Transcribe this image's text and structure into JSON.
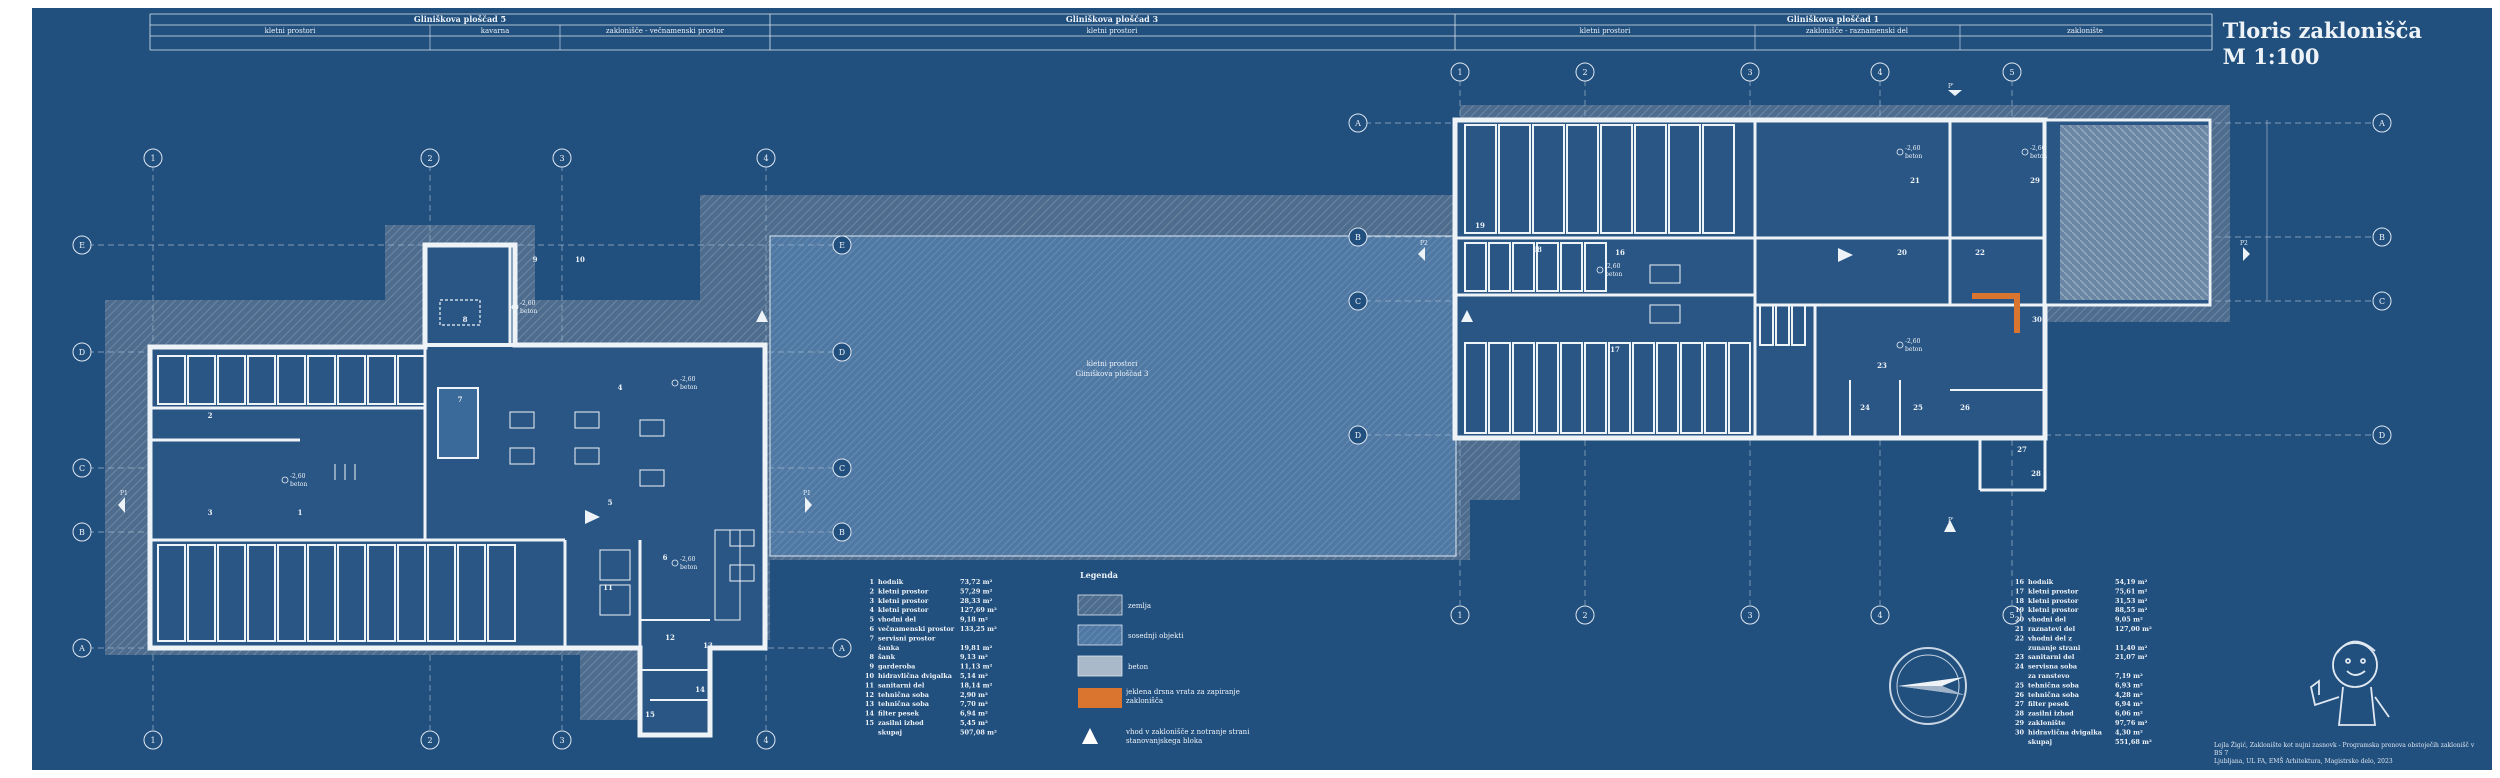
{
  "title": {
    "line1": "Tloris zaklonišča",
    "line2": "M  1:100"
  },
  "header": [
    {
      "name": "Gliniškova ploščad 5",
      "zones": [
        "kletni prostori",
        "kavarna",
        "zaklonišče - večnamenski prostor"
      ]
    },
    {
      "name": "Gliniškova ploščad 3",
      "zones": [
        "kletni prostori"
      ]
    },
    {
      "name": "Gliniškova ploščad 1",
      "zones": [
        "kletni prostori",
        "zaklonišče - raznamenski del",
        "zaklonište"
      ]
    }
  ],
  "plan_labels": {
    "central_1": "kletni prostori",
    "central_2": "Gliniškova ploščad 3",
    "beton": "beton",
    "beton_level": "-2,60",
    "p1": "P1",
    "p2": "P2",
    "p_prime": "P'"
  },
  "grid_left_numbers": [
    "1",
    "2",
    "3",
    "4"
  ],
  "grid_right_numbers": [
    "1",
    "2",
    "3",
    "4",
    "5"
  ],
  "grid_letters": [
    "E",
    "D",
    "C",
    "B",
    "A"
  ],
  "room_numbers_left": [
    "1",
    "2",
    "3",
    "4",
    "5",
    "6",
    "7",
    "8",
    "9",
    "10",
    "11",
    "12",
    "13",
    "14",
    "15"
  ],
  "room_numbers_right": [
    "16",
    "17",
    "18",
    "19",
    "20",
    "21",
    "22",
    "23",
    "24",
    "25",
    "26",
    "27",
    "28",
    "29",
    "30"
  ],
  "room_table_left": [
    {
      "n": "1",
      "name": "hodnik",
      "area": "73,72 m²"
    },
    {
      "n": "2",
      "name": "kletni prostor",
      "area": "57,29 m²"
    },
    {
      "n": "3",
      "name": "kletni prostor",
      "area": "28,33 m²"
    },
    {
      "n": "4",
      "name": "kletni prostor",
      "area": "127,69 m²"
    },
    {
      "n": "5",
      "name": "vhodni del",
      "area": "9,18 m²"
    },
    {
      "n": "6",
      "name": "večnamenski prostor",
      "area": "133,25 m²"
    },
    {
      "n": "7",
      "name": "servisni prostor",
      "area": ""
    },
    {
      "n": "",
      "name": "šanka",
      "area": "19,81 m²"
    },
    {
      "n": "8",
      "name": "šank",
      "area": "9,13 m²"
    },
    {
      "n": "9",
      "name": "garderoba",
      "area": "11,13 m²"
    },
    {
      "n": "10",
      "name": "hidravlična dvigalka",
      "area": "5,14 m²"
    },
    {
      "n": "11",
      "name": "sanitarni del",
      "area": "18,14 m²"
    },
    {
      "n": "12",
      "name": "tehnična soba",
      "area": "2,90 m²"
    },
    {
      "n": "13",
      "name": "tehnična soba",
      "area": "7,70 m²"
    },
    {
      "n": "14",
      "name": "filter pesek",
      "area": "6,94 m²"
    },
    {
      "n": "15",
      "name": "zasilni izhod",
      "area": "5,45 m²"
    },
    {
      "n": "",
      "name": "skupaj",
      "area": "507,08 m²"
    }
  ],
  "room_table_right": [
    {
      "n": "16",
      "name": "hodnik",
      "area": "54,19 m²"
    },
    {
      "n": "17",
      "name": "kletni prostor",
      "area": "75,61 m²"
    },
    {
      "n": "18",
      "name": "kletni prostor",
      "area": "31,53 m²"
    },
    {
      "n": "19",
      "name": "kletni prostor",
      "area": "88,55 m²"
    },
    {
      "n": "20",
      "name": "vhodni del",
      "area": "9,05 m²"
    },
    {
      "n": "21",
      "name": "raznatevi del",
      "area": "127,00 m²"
    },
    {
      "n": "22",
      "name": "vhodni del z",
      "area": ""
    },
    {
      "n": "",
      "name": "zunanje strani",
      "area": "11,40 m²"
    },
    {
      "n": "23",
      "name": "sanitarni del",
      "area": "21,07 m²"
    },
    {
      "n": "24",
      "name": "servisna soba",
      "area": ""
    },
    {
      "n": "",
      "name": "za ranstevo",
      "area": "7,19 m²"
    },
    {
      "n": "25",
      "name": "tehnična soba",
      "area": "6,93 m²"
    },
    {
      "n": "26",
      "name": "tehnična soba",
      "area": "4,28 m²"
    },
    {
      "n": "27",
      "name": "filter pesek",
      "area": "6,94 m²"
    },
    {
      "n": "28",
      "name": "zasilni izhod",
      "area": "6,06 m²"
    },
    {
      "n": "29",
      "name": "zaklonište",
      "area": "97,76 m²"
    },
    {
      "n": "30",
      "name": "hidravlična dvigalka",
      "area": "4,30 m²"
    },
    {
      "n": "",
      "name": "skupaj",
      "area": "551,68 m²"
    }
  ],
  "legend": {
    "title": "Legenda",
    "items": [
      {
        "label": "zemlja",
        "fill": "#5d7896"
      },
      {
        "label": "sosednji objekti",
        "fill": "#5e82aa"
      },
      {
        "label": "beton",
        "fill": "#a9b9c9"
      },
      {
        "label": "jeklena drsna vrata za zapiranje zaklonišča",
        "fill": "#d9752f"
      },
      {
        "label": "vhod v zaklonišče z notranje strani stanovanjskega bloka",
        "fill": "#ffffff"
      }
    ]
  },
  "credits": {
    "line1": "Lejla Žigić, Zaklonište kot nujni zasnovk - Programska prenova obstoječih zaklonišč v BS 7",
    "line2": "Ljubljana, UL FA, EMŠ Arhitektura, Magistrsko delo, 2023"
  },
  "colors": {
    "paper": "#214f7e",
    "line": "#eef3f8",
    "earth": "#5d7896",
    "accent": "#d9752f"
  }
}
